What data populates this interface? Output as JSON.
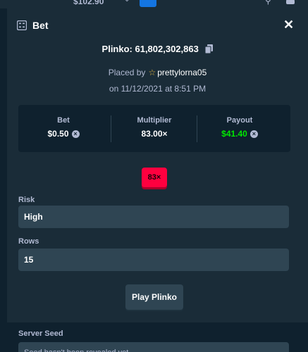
{
  "topbar": {
    "balance": "$102.90"
  },
  "modal": {
    "title": "Bet",
    "bet_id": "Plinko: 61,802,302,863",
    "placed_by_prefix": "Placed by",
    "username": "prettylorna05",
    "date": "on 11/12/2021 at 8:51 PM"
  },
  "stats": {
    "bet_label": "Bet",
    "bet_value": "$0.50",
    "multiplier_label": "Multiplier",
    "multiplier_value": "83.00×",
    "payout_label": "Payout",
    "payout_value": "$41.40",
    "payout_color": "#00e701"
  },
  "result": {
    "multiplier_badge": "83×",
    "badge_color": "#ff003f"
  },
  "form": {
    "risk_label": "Risk",
    "risk_value": "High",
    "rows_label": "Rows",
    "rows_value": "15",
    "play_button": "Play Plinko"
  },
  "seed": {
    "server_seed_label": "Server Seed",
    "server_seed_value": "Seed hasn't been revealed yet"
  }
}
